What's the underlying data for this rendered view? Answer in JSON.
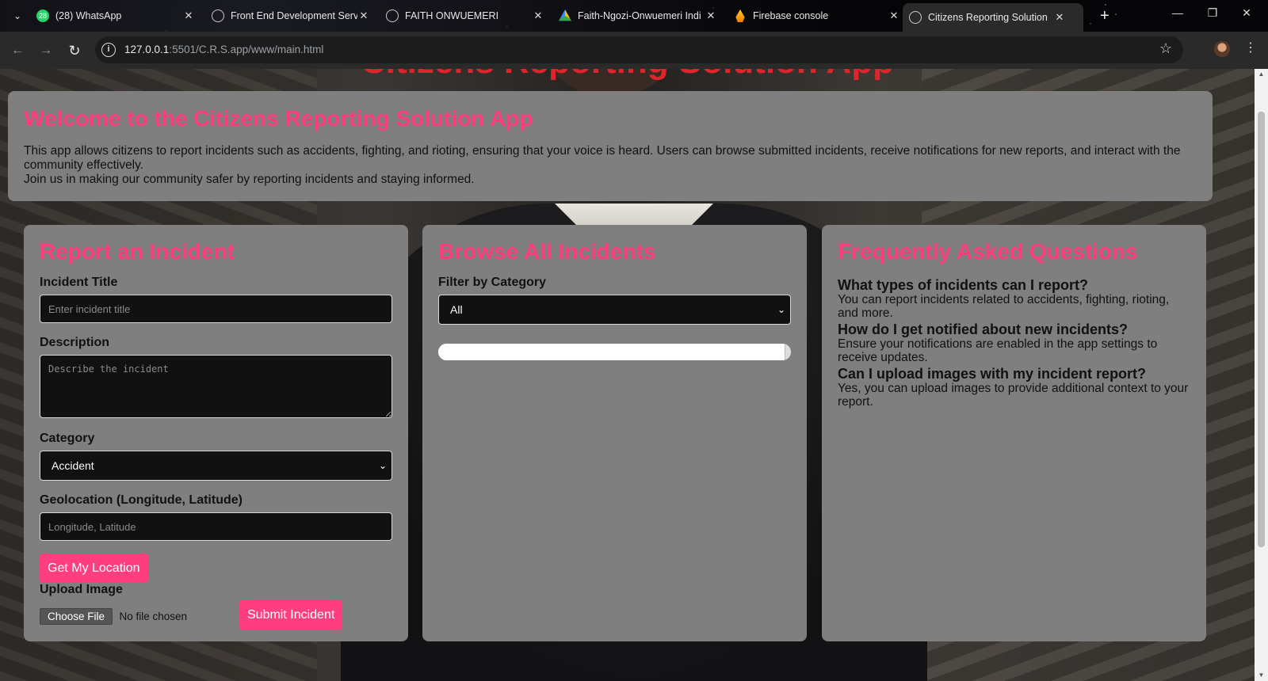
{
  "browser": {
    "tabs": [
      {
        "title": "(28) WhatsApp",
        "icon": "whatsapp-icon",
        "badge": "28"
      },
      {
        "title": "Front End Development Serv",
        "icon": "openai-icon"
      },
      {
        "title": "FAITH ONWUEMERI",
        "icon": "globe-icon"
      },
      {
        "title": "Faith-Ngozi-Onwuemeri Indi",
        "icon": "google-drive-icon"
      },
      {
        "title": "Firebase console",
        "icon": "firebase-icon"
      },
      {
        "title": "Citizens Reporting Solution",
        "icon": "globe-icon",
        "active": true
      }
    ],
    "url_host": "127.0.0.1",
    "url_path": ":5501/C.R.S.app/www/main.html"
  },
  "header": {
    "title": "Citizens Reporting Solution App"
  },
  "welcome": {
    "title": "Welcome to the Citizens Reporting Solution App",
    "line1": "This app allows citizens to report incidents such as accidents, fighting, and rioting, ensuring that your voice is heard. Users can browse submitted incidents, receive notifications for new reports, and interact with the community effectively.",
    "line2": "Join us in making our community safer by reporting incidents and staying informed."
  },
  "report": {
    "title": "Report an Incident",
    "incident_title_label": "Incident Title",
    "incident_title_placeholder": "Enter incident title",
    "description_label": "Description",
    "description_placeholder": "Describe the incident",
    "category_label": "Category",
    "category_value": "Accident",
    "geo_label": "Geolocation (Longitude, Latitude)",
    "geo_placeholder": "Longitude, Latitude",
    "get_location_button": "Get My Location",
    "upload_label": "Upload Image",
    "choose_file_button": "Choose File",
    "no_file_text": "No file chosen",
    "submit_button": "Submit Incident"
  },
  "browse": {
    "title": "Browse All Incidents",
    "filter_label": "Filter by Category",
    "filter_value": "All",
    "progress": 0.98
  },
  "faq": {
    "title": "Frequently Asked Questions",
    "items": [
      {
        "q": "What types of incidents can I report?",
        "a": "You can report incidents related to accidents, fighting, rioting, and more."
      },
      {
        "q": "How do I get notified about new incidents?",
        "a": "Ensure your notifications are enabled in the app settings to receive updates."
      },
      {
        "q": "Can I upload images with my incident report?",
        "a": "Yes, you can upload images to provide additional context to your report."
      }
    ]
  },
  "colors": {
    "accent": "#ff3e7f",
    "header_red": "#e0242c",
    "card_bg": "#7f7f7f",
    "field_bg": "#111111"
  }
}
